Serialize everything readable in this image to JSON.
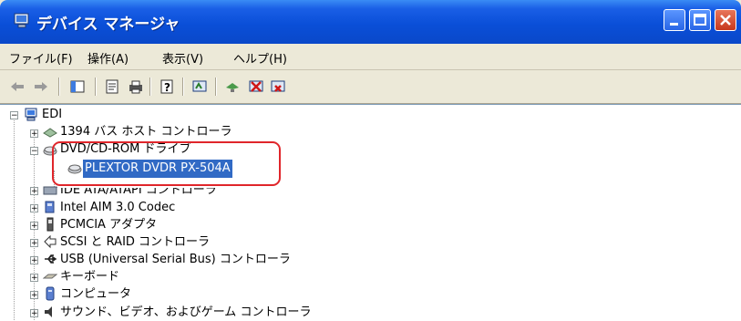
{
  "window": {
    "title": "デバイス マネージャ"
  },
  "menu": [
    "ファイル(F)",
    "操作(A)",
    "表示(V)",
    "ヘルプ(H)"
  ],
  "tree": {
    "root": "EDI",
    "items": [
      "1394 バス ホスト コントローラ",
      "DVD/CD-ROM ドライブ",
      "PLEXTOR DVDR   PX-504A",
      "IDE ATA/ATAPI コントローラ",
      "Intel AIM 3.0 Codec",
      "PCMCIA アダプタ",
      "SCSI と RAID コントローラ",
      "USB (Universal Serial Bus) コントローラ",
      "キーボード",
      "コンピュータ",
      "サウンド、ビデオ、およびゲーム コントローラ"
    ]
  },
  "colors": {
    "titlebar": "#0a4fd8",
    "selection": "#316ac5",
    "highlight_ring": "#e0262b"
  }
}
